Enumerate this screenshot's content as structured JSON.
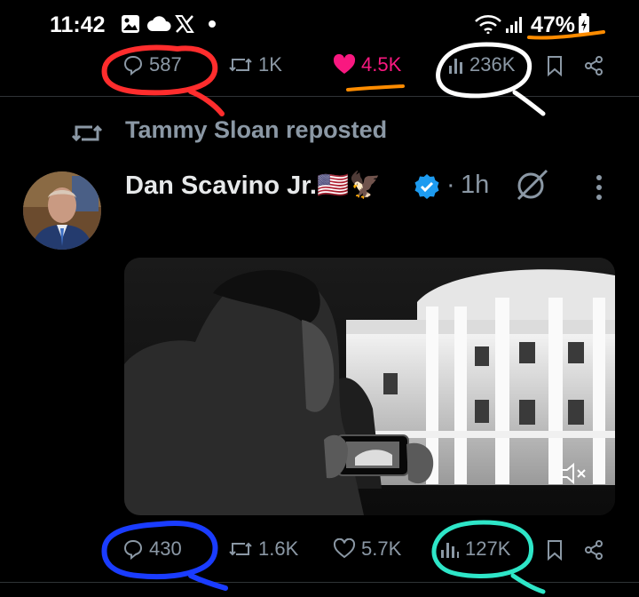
{
  "status_bar": {
    "time": "11:42",
    "battery": "47%",
    "icons": [
      "gallery-icon",
      "cloud-icon",
      "x-logo-icon",
      "dot-icon",
      "wifi-icon",
      "signal-icon",
      "battery-icon"
    ]
  },
  "top_actions": {
    "replies": "587",
    "reposts": "1K",
    "likes": "4.5K",
    "views": "236K",
    "liked": true
  },
  "repost_header": {
    "label": "Tammy Sloan reposted"
  },
  "post": {
    "author_name": "Dan Scavino Jr.🇺🇸🦅",
    "verified": true,
    "separator": "·",
    "time_ago": "1h"
  },
  "bottom_actions": {
    "replies": "430",
    "reposts": "1.6K",
    "likes": "5.7K",
    "views": "127K"
  },
  "colors": {
    "background": "#000000",
    "muted_text": "#8b98a5",
    "like_pink": "#f91880",
    "verified_blue": "#1d9bf0",
    "annotation_red": "#ff2d2d",
    "annotation_orange": "#ff8c00",
    "annotation_white": "#ffffff",
    "annotation_blue": "#1a3cff",
    "annotation_teal": "#2ee6c8"
  }
}
